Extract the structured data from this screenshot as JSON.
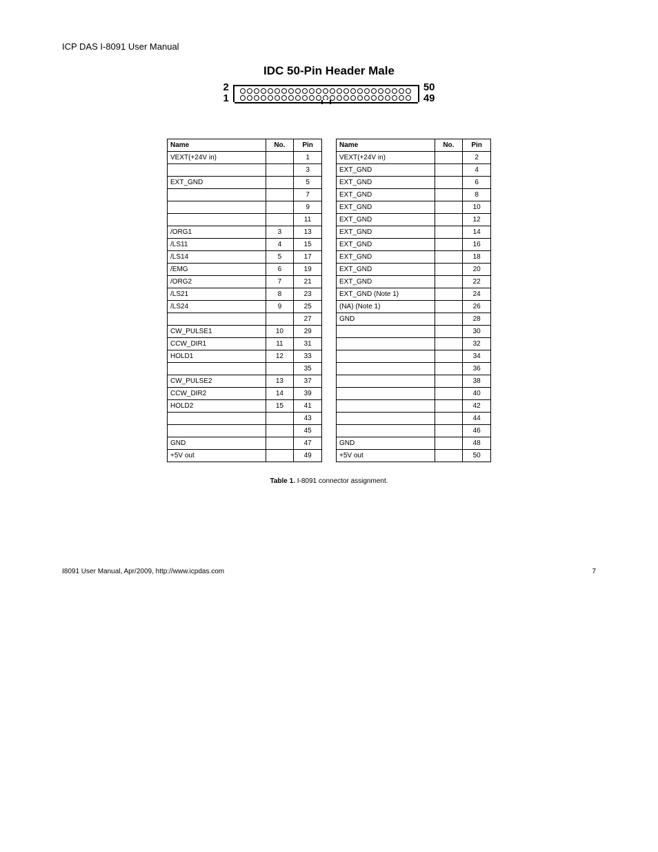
{
  "top_title": "ICP DAS I-8091 User Manual",
  "connector_title": "IDC 50-Pin Header Male",
  "pin_labels": {
    "tl": "2",
    "bl": "1",
    "tr": "50",
    "br": "49"
  },
  "header": {
    "left": [
      "Name",
      "No.",
      "Pin"
    ],
    "right": [
      "Name",
      "No.",
      "Pin"
    ]
  },
  "left_rows": [
    [
      "VEXT(+24V in)",
      "",
      "1"
    ],
    [
      "",
      "",
      "3"
    ],
    [
      "EXT_GND",
      "",
      "5"
    ],
    [
      "",
      "",
      "7"
    ],
    [
      "",
      "",
      "9"
    ],
    [
      "",
      "",
      "11"
    ],
    [
      "/ORG1",
      "3",
      "13"
    ],
    [
      "/LS11",
      "4",
      "15"
    ],
    [
      "/LS14",
      "5",
      "17"
    ],
    [
      "/EMG",
      "6",
      "19"
    ],
    [
      "/ORG2",
      "7",
      "21"
    ],
    [
      "/LS21",
      "8",
      "23"
    ],
    [
      "/LS24",
      "9",
      "25"
    ],
    [
      "",
      "",
      "27"
    ],
    [
      "CW_PULSE1",
      "10",
      "29"
    ],
    [
      "CCW_DIR1",
      "11",
      "31"
    ],
    [
      "HOLD1",
      "12",
      "33"
    ],
    [
      "",
      "",
      "35"
    ],
    [
      "CW_PULSE2",
      "13",
      "37"
    ],
    [
      "CCW_DIR2",
      "14",
      "39"
    ],
    [
      "HOLD2",
      "15",
      "41"
    ],
    [
      "",
      "",
      "43"
    ],
    [
      "",
      "",
      "45"
    ],
    [
      "GND",
      "",
      "47"
    ],
    [
      "+5V out",
      "",
      "49"
    ]
  ],
  "right_rows": [
    [
      "VEXT(+24V in)",
      "",
      "2"
    ],
    [
      "EXT_GND",
      "",
      "4"
    ],
    [
      "EXT_GND",
      "",
      "6"
    ],
    [
      "EXT_GND",
      "",
      "8"
    ],
    [
      "EXT_GND",
      "",
      "10"
    ],
    [
      "EXT_GND",
      "",
      "12"
    ],
    [
      "EXT_GND",
      "",
      "14"
    ],
    [
      "EXT_GND",
      "",
      "16"
    ],
    [
      "EXT_GND",
      "",
      "18"
    ],
    [
      "EXT_GND",
      "",
      "20"
    ],
    [
      "EXT_GND",
      "",
      "22"
    ],
    [
      "EXT_GND (Note 1)",
      "",
      "24"
    ],
    [
      "(NA) (Note 1)",
      "",
      "26"
    ],
    [
      "GND",
      "",
      "28"
    ],
    [
      "",
      "",
      "30"
    ],
    [
      "",
      "",
      "32"
    ],
    [
      "",
      "",
      "34"
    ],
    [
      "",
      "",
      "36"
    ],
    [
      "",
      "",
      "38"
    ],
    [
      "",
      "",
      "40"
    ],
    [
      "",
      "",
      "42"
    ],
    [
      "",
      "",
      "44"
    ],
    [
      "",
      "",
      "46"
    ],
    [
      "GND",
      "",
      "48"
    ],
    [
      "+5V out",
      "",
      "50"
    ]
  ],
  "caption_bold": "Table 1.",
  "caption_rest": " I-8091 connector assignment.",
  "footer_left": "I8091 User Manual, Apr/2009, http://www.icpdas.com",
  "footer_right": "7"
}
